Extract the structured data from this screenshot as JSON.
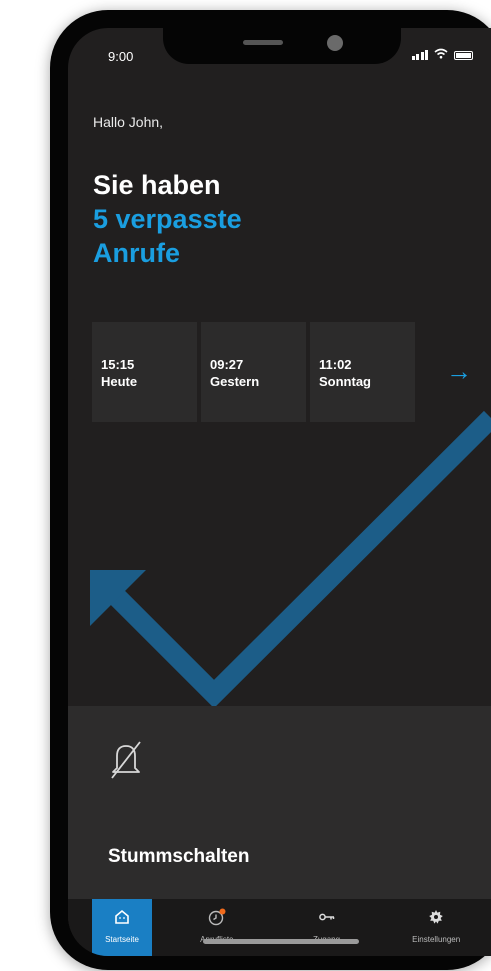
{
  "status_bar": {
    "time": "9:00"
  },
  "greeting": "Hallo John,",
  "headline": {
    "line1": "Sie haben",
    "line2": "5 verpasste",
    "line3": "Anrufe"
  },
  "missed_calls": [
    {
      "time": "15:15",
      "day": "Heute"
    },
    {
      "time": "09:27",
      "day": "Gestern"
    },
    {
      "time": "11:02",
      "day": "Sonntag"
    }
  ],
  "next_arrow": "→",
  "mute": {
    "label": "Stummschalten"
  },
  "tabs": [
    {
      "label": "Startseite",
      "icon": "home-icon",
      "active": true
    },
    {
      "label": "Anrufliste",
      "icon": "clock-icon",
      "active": false
    },
    {
      "label": "Zugang",
      "icon": "key-icon",
      "active": false
    },
    {
      "label": "Einstellungen",
      "icon": "gear-icon",
      "active": false
    }
  ],
  "colors": {
    "accent": "#1a9ee0",
    "background": "#211f1f",
    "card": "#2c2b2b",
    "tab_active": "#1a7fc4",
    "badge": "#f26a1b"
  }
}
